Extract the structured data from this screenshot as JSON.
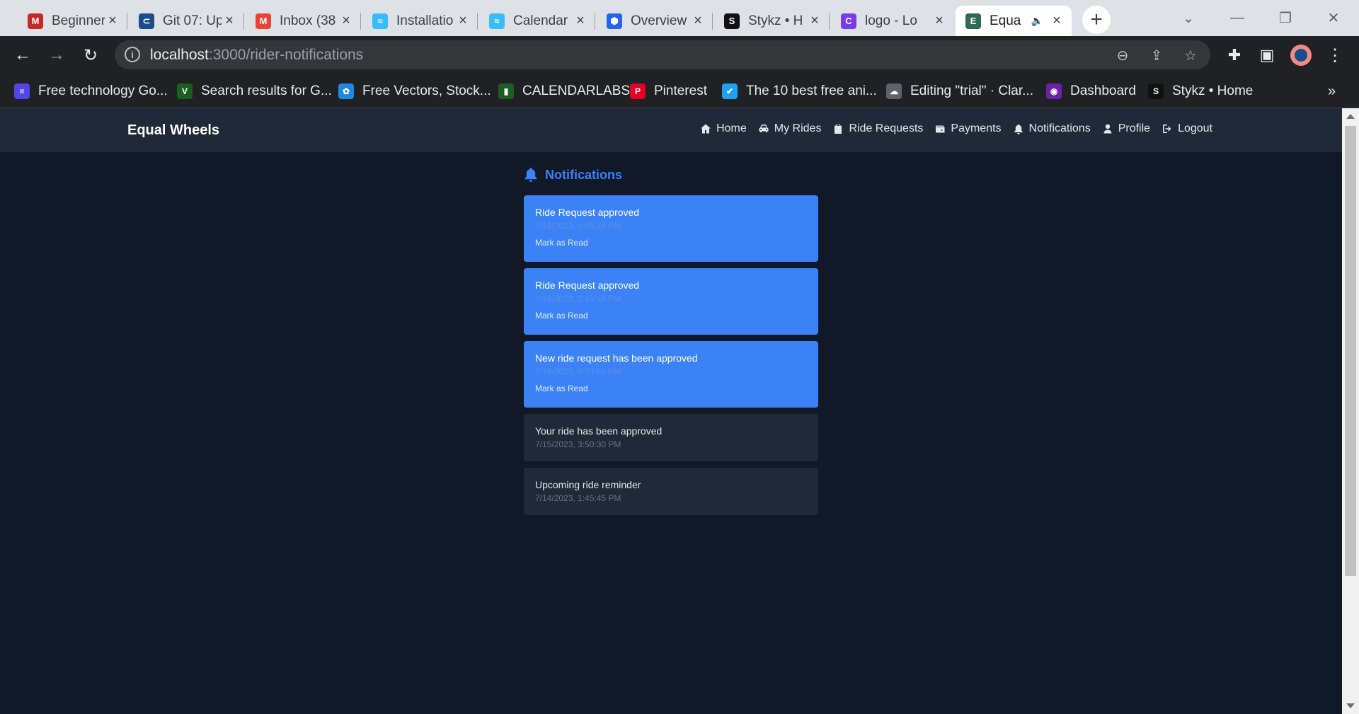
{
  "browser": {
    "tabs": [
      {
        "title": "Beginner",
        "icon": "m-logo-icon",
        "color": "#c62828",
        "glyph": "M"
      },
      {
        "title": "Git 07: Up",
        "icon": "link-logo-icon",
        "color": "#1a4c8c",
        "glyph": "⊂"
      },
      {
        "title": "Inbox (38",
        "icon": "gmail-icon",
        "color": "#ea4335",
        "glyph": "M"
      },
      {
        "title": "Installatio",
        "icon": "tailwind-icon",
        "color": "#38bdf8",
        "glyph": "≈"
      },
      {
        "title": "Calendar",
        "icon": "tailwind-icon",
        "color": "#38bdf8",
        "glyph": "≈"
      },
      {
        "title": "Overview",
        "icon": "shield-logo-icon",
        "color": "#2563eb",
        "glyph": "⬢"
      },
      {
        "title": "Stykz • H",
        "icon": "stykz-icon",
        "color": "#111111",
        "glyph": "S"
      },
      {
        "title": "logo - Lo",
        "icon": "canva-icon",
        "color": "#7c3aed",
        "glyph": "C"
      },
      {
        "title": "Equa",
        "icon": "equal-wheels-favicon",
        "color": "#2d6a4f",
        "glyph": "E",
        "active": true
      }
    ],
    "url_host": "localhost",
    "url_path": ":3000/rider-notifications",
    "bookmarks": [
      {
        "label": "Free technology Go...",
        "icon": "layers-icon",
        "color": "#4f46e5",
        "glyph": "≡"
      },
      {
        "label": "Search results for G...",
        "icon": "vuetify-icon",
        "color": "#1b5e20",
        "glyph": "V"
      },
      {
        "label": "Free Vectors, Stock...",
        "icon": "freepik-icon",
        "color": "#1e88e5",
        "glyph": "✿"
      },
      {
        "label": "CALENDARLABS",
        "icon": "calendar-icon",
        "color": "#1b5e20",
        "glyph": "▮"
      },
      {
        "label": "Pinterest",
        "icon": "pinterest-icon",
        "color": "#e60023",
        "glyph": "P"
      },
      {
        "label": "The 10 best free ani...",
        "icon": "bird-icon",
        "color": "#1da1f2",
        "glyph": "✔"
      },
      {
        "label": "Editing \"trial\" · Clar...",
        "icon": "cloud-icon",
        "color": "#5f6368",
        "glyph": "☁"
      },
      {
        "label": "Dashboard",
        "icon": "dashboard-icon",
        "color": "#6b21a8",
        "glyph": "◉"
      },
      {
        "label": "Stykz • Home",
        "icon": "stykz-icon",
        "color": "#111111",
        "glyph": "S"
      }
    ]
  },
  "app": {
    "brand": "Equal Wheels",
    "nav": [
      {
        "label": "Home",
        "icon": "home-icon"
      },
      {
        "label": "My Rides",
        "icon": "car-icon"
      },
      {
        "label": "Ride Requests",
        "icon": "clipboard-icon"
      },
      {
        "label": "Payments",
        "icon": "wallet-icon"
      },
      {
        "label": "Notifications",
        "icon": "bell-icon"
      },
      {
        "label": "Profile",
        "icon": "user-icon"
      },
      {
        "label": "Logout",
        "icon": "logout-icon"
      }
    ],
    "heading": "Notifications",
    "notifications": [
      {
        "message": "Ride Request approved",
        "time": "7/16/2023, 1:45:16 PM",
        "action": "Mark as Read",
        "unread": true
      },
      {
        "message": "Ride Request approved",
        "time": "7/16/2023, 1:45:16 PM",
        "action": "Mark as Read",
        "unread": true
      },
      {
        "message": "New ride request has been approved",
        "time": "7/16/2023, 6:03:56 PM",
        "action": "Mark as Read",
        "unread": true
      },
      {
        "message": "Your ride has been approved",
        "time": "7/15/2023, 3:50:30 PM",
        "unread": false
      },
      {
        "message": "Upcoming ride reminder",
        "time": "7/14/2023, 1:45:45 PM",
        "unread": false
      }
    ]
  },
  "colors": {
    "page_bg": "#111827",
    "nav_bg": "#1f2937",
    "accent": "#3b82f6",
    "read_card": "#1f2937"
  }
}
